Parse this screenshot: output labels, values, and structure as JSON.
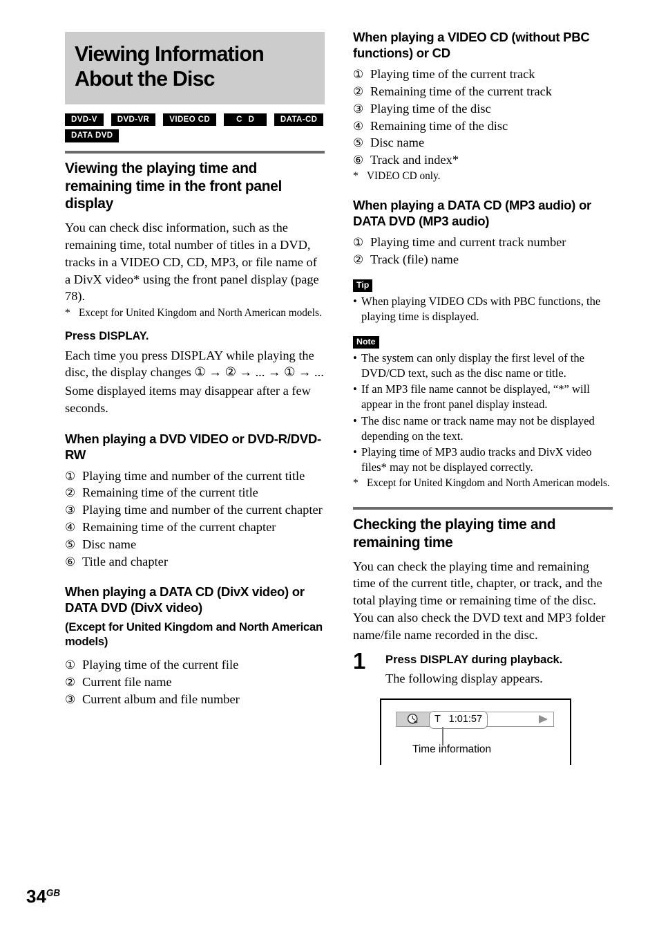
{
  "page": {
    "number": "34",
    "region_suffix": "GB"
  },
  "chapter": {
    "title": "Viewing Information About the Disc",
    "banner_color": "#cccccc"
  },
  "disc_badges": [
    {
      "label": "DVD-V"
    },
    {
      "label": "DVD-VR"
    },
    {
      "label": "VIDEO CD"
    },
    {
      "label": "C D"
    },
    {
      "label": "DATA-CD"
    },
    {
      "label": "DATA DVD"
    }
  ],
  "left_column": {
    "section1": {
      "heading": "Viewing the playing time and remaining time in the front panel display",
      "intro": "You can check disc information, such as the remaining time, total number of titles in a DVD, tracks in a VIDEO CD, CD, MP3, or file name of a DivX video* using the front panel display (page 78).",
      "footnote_marker": "*",
      "footnote": "Except for United Kingdom and North American models.",
      "press_display_heading": "Press DISPLAY.",
      "press_display_body1": "Each time you press DISPLAY while playing the disc, the display changes ① → ② → ... → ① → ...",
      "press_display_body2": "Some displayed items may disappear after a few seconds."
    },
    "dvd_video_section": {
      "heading": "When playing a DVD VIDEO or DVD-R/DVD-RW",
      "items": [
        {
          "num": "①",
          "text": "Playing time and number of the current title"
        },
        {
          "num": "②",
          "text": "Remaining time of the current title"
        },
        {
          "num": "③",
          "text": "Playing time and number of the current chapter"
        },
        {
          "num": "④",
          "text": "Remaining time of the current chapter"
        },
        {
          "num": "⑤",
          "text": "Disc name"
        },
        {
          "num": "⑥",
          "text": "Title and chapter"
        }
      ]
    },
    "divx_section": {
      "heading": "When playing a DATA CD (DivX video) or DATA DVD (DivX video)",
      "subheading": "(Except for United Kingdom and North American models)",
      "items": [
        {
          "num": "①",
          "text": "Playing time of the current file"
        },
        {
          "num": "②",
          "text": "Current file name"
        },
        {
          "num": "③",
          "text": "Current album and file number"
        }
      ]
    }
  },
  "right_column": {
    "video_cd_section": {
      "heading": "When playing a VIDEO CD (without PBC functions) or CD",
      "items": [
        {
          "num": "①",
          "text": "Playing time of the current track"
        },
        {
          "num": "②",
          "text": "Remaining time of the current track"
        },
        {
          "num": "③",
          "text": "Playing time of the disc"
        },
        {
          "num": "④",
          "text": "Remaining time of the disc"
        },
        {
          "num": "⑤",
          "text": "Disc name"
        },
        {
          "num": "⑥",
          "text": "Track and index*"
        }
      ],
      "footnote_marker": "*",
      "footnote": "VIDEO CD only."
    },
    "mp3_section": {
      "heading": "When playing a DATA CD (MP3 audio) or DATA DVD (MP3 audio)",
      "items": [
        {
          "num": "①",
          "text": "Playing time and current track number"
        },
        {
          "num": "②",
          "text": "Track (file) name"
        }
      ]
    },
    "tip": {
      "label": "Tip",
      "bullets": [
        "When playing VIDEO CDs with PBC functions, the playing time is displayed."
      ]
    },
    "note": {
      "label": "Note",
      "bullets": [
        "The system can only display the first level of the DVD/CD text, such as the disc name or title.",
        "If an MP3 file name cannot be displayed, “*” will appear in the front panel display instead.",
        "The disc name or track name may not be displayed depending on the text.",
        "Playing time of MP3 audio tracks and DivX video files* may not be displayed correctly."
      ],
      "footnote_marker": "*",
      "footnote": "Except for United Kingdom and North American models."
    },
    "checking_section": {
      "heading": "Checking the playing time and remaining time",
      "intro": "You can check the playing time and remaining time of the current title, chapter, or track, and the total playing time or remaining time of the disc. You can also check the DVD text and MP3 folder name/file name recorded in the disc.",
      "step": {
        "number": "1",
        "title": "Press DISPLAY during playback.",
        "description": "The following display appears."
      },
      "illustration": {
        "osd_time_value": "T   1:01:57",
        "caption": "Time information",
        "icon_name": "clock-icon",
        "play_icon_name": "play-triangle-icon"
      }
    }
  }
}
